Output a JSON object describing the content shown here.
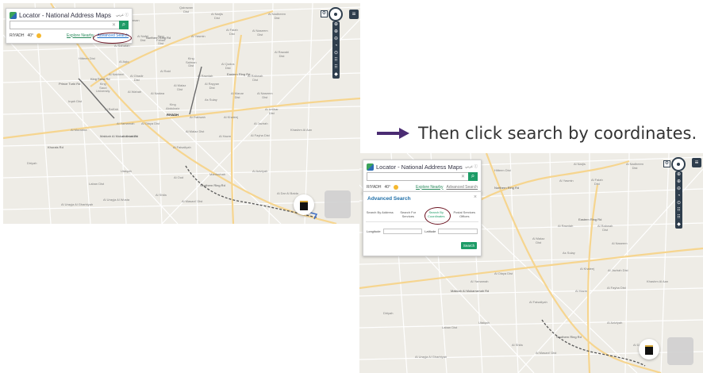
{
  "instruction": {
    "text": "Then click search by coordinates."
  },
  "locator": {
    "title": "Locator - National Address Maps",
    "lang": "عربي ⓘ",
    "city": "RIYADH",
    "temperature": "40°",
    "explore": "Explore Nearby",
    "advanced": "Advanced Search",
    "search_icon": "⌕",
    "clear_icon": "✕"
  },
  "advanced_search": {
    "title": "Advanced Search",
    "close": "×",
    "tabs": [
      {
        "label": "Search By Address"
      },
      {
        "label": "Search For Services"
      },
      {
        "label": "Search By Coordinates"
      },
      {
        "label": "Postal Services Offices"
      }
    ],
    "longitude_label": "Longitude",
    "latitude_label": "Latitude",
    "search_button": "Search"
  },
  "controls": {
    "menu": "≡",
    "items": [
      "⊕",
      "⊕",
      "⊖",
      "◔",
      "⊙",
      "⠿",
      "⠿",
      "◆"
    ]
  },
  "map_labels": {
    "shot1": [
      "Qairawan Dist",
      "Al Qirawan",
      "Al Narjis",
      "Al Nadheem Dist",
      "King Fahad Dist",
      "Al Yasmin",
      "Al Falah Dist",
      "Al Nafel Dist",
      "Al Naseem Dist",
      "Al Rawabi Dist",
      "Al Yarmuk",
      "Hitteen Dist",
      "Al Sahafah",
      "Al Aqiq",
      "King Salman Dist",
      "Al Ghadir Dist",
      "Al Nakheel",
      "Al Wahah",
      "Al Qudus Dist",
      "Al Rabwah Dist",
      "Al Malaz Dist",
      "King Saud University",
      "Al Raid",
      "Al Rayyan Dist",
      "Al Nadwa",
      "As Sulay",
      "Al Manar Dist",
      "Al Rawdah",
      "Al Naseem Dist",
      "Al Izdihar Dist",
      "Ar Rabwah",
      "Al Khaleej",
      "King Abdulaziz",
      "Al Jazirah",
      "Irqah Dist",
      "Al Rafi'ah",
      "Al Malaz Dist",
      "Al Yamamah",
      "Al Hazm",
      "Khashm Al Aan",
      "Al Faisaliyah",
      "Al Olaya Dist",
      "Al Murabba",
      "Al Sa'adah",
      "Al Fayha Dist",
      "Laban Dist",
      "Diriyah",
      "Utaiqah",
      "Al Oud",
      "Manfouhah",
      "Al Aziziyah",
      "Al Dar Al Baida",
      "Al Shifa",
      "Al Masani' Dist",
      "Al Urayja Al Gharbiyah",
      "Al Urayja Al Wusta",
      "King Fahd Rd",
      "Prince Turki Rd",
      "Northern Ring Rd",
      "Eastern Ring Rd",
      "Makkah Al Mukarramah Rd",
      "Southern Ring Rd",
      "Khurais Rd"
    ],
    "shot2": [
      "Al Nadheem Dist",
      "Al Yasmin",
      "Al Narjis",
      "Hitteen Dist",
      "Al Falah Dist",
      "Al Rabwah Dist",
      "Al Rawdah",
      "Al Naseem",
      "Al Malaz Dist",
      "As Sulay",
      "Al Jazirah Dist",
      "Al Olaya Dist",
      "Khashm Al Aan",
      "Al Fayha Dist",
      "Diriyah",
      "Laban Dist",
      "Al Khaleej",
      "Al Yamamah",
      "Al Faisaliyah",
      "Al Hazm",
      "Utaiqah",
      "Al Aziziyah",
      "Al Dar Al Baida",
      "Al Shifa",
      "Al Masani' Dist",
      "Al Urayja Al Gharbiyah",
      "Northern Ring Rd",
      "Eastern Ring Rd",
      "Makkah Al Mukarramah Rd",
      "Southern Ring Rd"
    ]
  }
}
